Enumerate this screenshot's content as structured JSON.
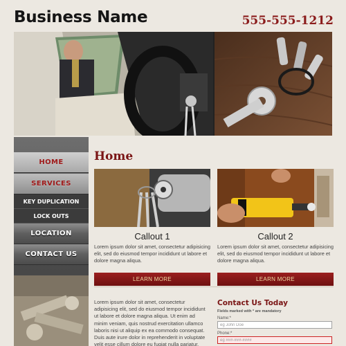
{
  "header": {
    "brand": "Business Name",
    "phone": "555-555-1212"
  },
  "nav": {
    "home": "HOME",
    "services": "SERVICES",
    "key_duplication": "KEY DUPLICATION",
    "lock_outs": "LOCK OUTS",
    "location": "LOCATION",
    "contact_us": "CONTACT US"
  },
  "main": {
    "title": "Home",
    "callouts": [
      {
        "title": "Callout 1",
        "text": "Lorem ipsum dolor sit amet, consectetur adipisicing elit, sed do eiusmod tempor incididunt ut labore et dolore magna aliqua.",
        "button": "LEARN MORE"
      },
      {
        "title": "Callout 2",
        "text": "Lorem ipsum dolor sit amet, consectetur adipisicing elit, sed do eiusmod tempor incididunt ut labore et dolore magna aliqua.",
        "button": "LEARN MORE"
      }
    ],
    "body_text": "Lorem ipsum dolor sit amet, consectetur adipisicing elit, sed do eiusmod tempor incididunt ut labore et dolore magna aliqua. Ut enim ad minim veniam, quis nostrud exercitation ullamco laboris nisi ut aliquip ex ea commodo consequat. Duis aute irure dolor in reprehenderit in voluptate velit esse cillum dolore eu fugiat nulla pariatur."
  },
  "contact": {
    "title": "Contact Us Today",
    "note": "Fields marked with * are mandatory",
    "name_label": "Name:*",
    "name_placeholder": "eg John Doe",
    "phone_label": "Phone:*",
    "phone_placeholder": "eg ###-###-####"
  },
  "colors": {
    "accent": "#7a1515",
    "button": "#8a1a1a",
    "button_text": "#f0d9a2",
    "background": "#ece8e1"
  }
}
